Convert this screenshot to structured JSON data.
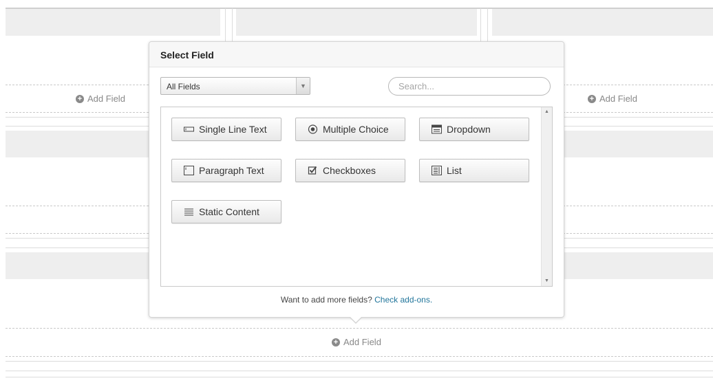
{
  "background": {
    "add_field_label": "Add Field"
  },
  "modal": {
    "title": "Select Field",
    "filter": {
      "selected": "All Fields"
    },
    "search": {
      "placeholder": "Search..."
    },
    "fields": [
      {
        "label": "Single Line Text",
        "icon": "single-line-text-icon"
      },
      {
        "label": "Multiple Choice",
        "icon": "radio-icon"
      },
      {
        "label": "Dropdown",
        "icon": "dropdown-icon"
      },
      {
        "label": "Paragraph Text",
        "icon": "paragraph-text-icon"
      },
      {
        "label": "Checkboxes",
        "icon": "checkbox-icon"
      },
      {
        "label": "List",
        "icon": "list-icon"
      },
      {
        "label": "Static Content",
        "icon": "static-content-icon"
      }
    ],
    "footer": {
      "text": "Want to add more fields?",
      "link": "Check add-ons."
    }
  },
  "colors": {
    "link": "#21759b",
    "placeholder_bar": "#eeeeee"
  }
}
